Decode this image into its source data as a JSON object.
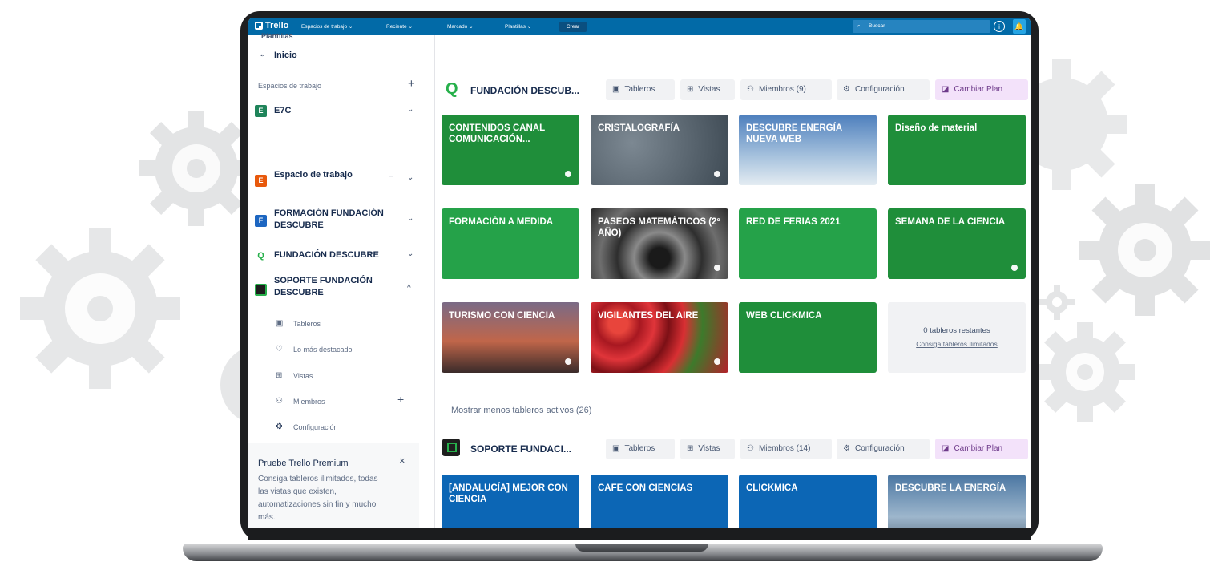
{
  "topbar": {
    "logo": "Trello",
    "menus": [
      "Espacios de trabajo ⌄",
      "Reciente ⌄",
      "Marcado ⌄",
      "Plantillas ⌄"
    ],
    "create": "Crear",
    "search_label": "Buscar",
    "info_icon": "i",
    "bell_icon": "🔔"
  },
  "sidebar": {
    "cut_item": "Plantillas",
    "home": "Inicio",
    "section_title": "Espacios de trabajo",
    "workspaces": [
      {
        "badge": "E",
        "line1": "E7C",
        "line2": "",
        "color": "#1f845a"
      },
      {
        "badge": "E",
        "line1": "Espacio de trabajo",
        "line2": "",
        "color": "#e8590c"
      },
      {
        "badge": "F",
        "line1": "FORMACIÓN FUNDACIÓN",
        "line2": "DESCUBRE",
        "color": "#1d66c1"
      },
      {
        "badge": "Q",
        "line1": "FUNDACIÓN DESCUBRE",
        "line2": "",
        "color": "#ffffff"
      },
      {
        "badge": "",
        "line1": "SOPORTE FUNDACIÓN",
        "line2": "DESCUBRE",
        "color": "#1e1e1e"
      }
    ],
    "sub_items": [
      "Tableros",
      "Lo más destacado",
      "Vistas",
      "Miembros",
      "Configuración"
    ],
    "promo": {
      "title": "Pruebe Trello Premium",
      "close": "×",
      "lines": [
        "Consiga tableros ilimitados, todas",
        "las vistas que existen,",
        "automatizaciones sin fin y mucho",
        "más."
      ]
    }
  },
  "workspace1": {
    "title": "FUNDACIÓN DESCUB...",
    "logo_letter": "Q",
    "buttons": {
      "tableros": "Tableros",
      "vistas": "Vistas",
      "miembros": "Miembros (9)",
      "config": "Configuración",
      "cambiar": "Cambiar Plan"
    },
    "boards": [
      {
        "title": "CONTENIDOS CANAL COMUNICACIÓN...",
        "bg": "#1f8e3a",
        "dot": true
      },
      {
        "title": "CRISTALOGRAFÍA",
        "bg": "#4b5a66",
        "dot": true
      },
      {
        "title": "DESCUBRE ENERGÍA NUEVA WEB",
        "bg": "#6c93bd",
        "dot": false
      },
      {
        "title": "Diseño de material",
        "bg": "#1f8e3a",
        "dot": false
      },
      {
        "title": "FORMACIÓN A MEDIDA",
        "bg": "#25a249",
        "dot": false
      },
      {
        "title": "PASEOS MATEMÁTICOS (2º AÑO)",
        "bg": "#3b3b3b",
        "dot": true
      },
      {
        "title": "RED DE FERIAS 2021",
        "bg": "#25a249",
        "dot": false
      },
      {
        "title": "SEMANA DE LA CIENCIA",
        "bg": "#1f8e3a",
        "dot": true
      },
      {
        "title": "TURISMO CON CIENCIA",
        "bg": "#b5543a",
        "dot": true
      },
      {
        "title": "VIGILANTES DEL AIRE",
        "bg": "#c8232c",
        "dot": true
      },
      {
        "title": "WEB CLICKMICA",
        "bg": "#1f8e3a",
        "dot": false
      }
    ],
    "remaining_title": "0 tableros restantes",
    "remaining_link": "Consiga tableros ilimitados",
    "show_less": "Mostrar menos tableros activos (26)"
  },
  "workspace2": {
    "title": "SOPORTE FUNDACI...",
    "buttons": {
      "tableros": "Tableros",
      "vistas": "Vistas",
      "miembros": "Miembros (14)",
      "config": "Configuración",
      "cambiar": "Cambiar Plan"
    },
    "boards": [
      {
        "title": "[ANDALUCÍA] MEJOR CON CIENCIA",
        "bg": "#0c66b5",
        "dot": true
      },
      {
        "title": "CAFE CON CIENCIAS",
        "bg": "#0c66b5",
        "dot": true
      },
      {
        "title": "CLICKMICA",
        "bg": "#0c66b5",
        "dot": false
      },
      {
        "title": "DESCUBRE LA ENERGÍA",
        "bg": "#5c88ad",
        "dot": false
      }
    ]
  },
  "colors": {
    "topbar": "#026aa7",
    "green": "#1f8e3a",
    "blue": "#0c66b5",
    "purple": "#6e3a8a"
  }
}
